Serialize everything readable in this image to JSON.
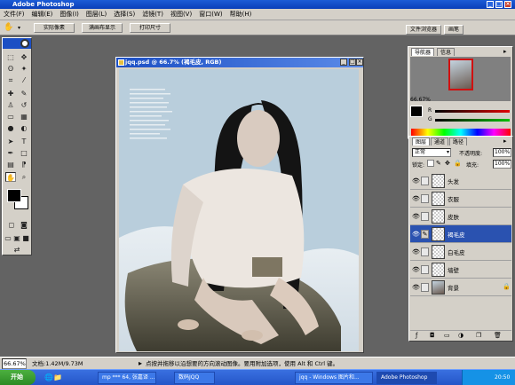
{
  "app": {
    "title": "Adobe Photoshop"
  },
  "menu": [
    "文件(F)",
    "编辑(E)",
    "图像(I)",
    "图层(L)",
    "选择(S)",
    "滤镜(T)",
    "视图(V)",
    "窗口(W)",
    "帮助(H)"
  ],
  "options": {
    "actual_pixels": "实际像素",
    "fit_screen": "满画布显示",
    "print_size": "打印尺寸"
  },
  "palette_well": {
    "file_browser": "文件浏览器",
    "brushes": "画笔"
  },
  "document": {
    "title": "jqq.psd @ 66.7% (褐毛皮, RGB)"
  },
  "navigator": {
    "tabs": [
      "导航器",
      "信息"
    ],
    "zoom": "66.67%"
  },
  "color": {
    "r_label": "R",
    "g_label": "G",
    "r_value": "",
    "g_value": ""
  },
  "layers_panel": {
    "tabs": [
      "图层",
      "通道",
      "路径"
    ],
    "blend_mode": "正常",
    "opacity_label": "不透明度:",
    "opacity_value": "100%",
    "lock_label": "锁定:",
    "fill_label": "填充:",
    "fill_value": "100%",
    "layers": [
      {
        "name": "头发",
        "selected": false
      },
      {
        "name": "衣服",
        "selected": false
      },
      {
        "name": "皮肤",
        "selected": false
      },
      {
        "name": "褐毛皮",
        "selected": true
      },
      {
        "name": "白毛皮",
        "selected": false
      },
      {
        "name": "墙壁",
        "selected": false
      },
      {
        "name": "背景",
        "selected": false
      }
    ]
  },
  "status": {
    "zoom": "66.67%",
    "doc_size": "文档:1.42M/9.73M",
    "hint": "点按并拖移以沿想要的方向滚动图像。要用附加选项，使用 Alt 和 Ctrl 键。"
  },
  "taskbar": {
    "start": "开始",
    "tasks": [
      "mp *** 64, 张嘉译 ...",
      "数码JQQ",
      "jqq - Windows 图片和...",
      "Adobe Photoshop"
    ],
    "clock": "20:50"
  }
}
